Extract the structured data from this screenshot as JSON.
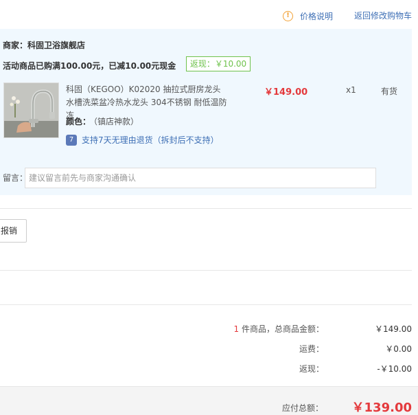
{
  "header": {
    "price_help": "价格说明",
    "back_to_cart": "返回修改购物车"
  },
  "merchant": {
    "label": "商家：",
    "name": "科固卫浴旗舰店",
    "promo_text": "活动商品已购满100.00元，已减10.00元现金",
    "rebate_tag": "返现：￥10.00"
  },
  "product": {
    "title": "科固（KEGOO）K02020 抽拉式厨房龙头 水槽洗菜盆冷热水龙头 304不锈钢 耐低温防冻",
    "price": "￥149.00",
    "qty": "x1",
    "stock": "有货",
    "color_label": "颜色：",
    "color_value": "（镇店神款）",
    "return_policy": "支持7天无理由退货（拆封后不支持）",
    "return_icon": "7"
  },
  "message": {
    "label": "留言：",
    "placeholder": "建议留言前先与商家沟通确认"
  },
  "invoice": {
    "button_label": "报销"
  },
  "summary": {
    "count": "1",
    "count_label": " 件商品，总商品金额：",
    "goods_total": "￥149.00",
    "shipping_label": "运费：",
    "shipping": "￥0.00",
    "rebate_label": "返现：",
    "rebate": "-￥10.00",
    "payable_label": "应付总额：",
    "payable": "￥139.00"
  },
  "colors": {
    "accent_red": "#e4393c",
    "link_blue": "#3e6fb5",
    "rebate_green": "#6ec24b",
    "panel_bg": "#f0f8fe"
  }
}
